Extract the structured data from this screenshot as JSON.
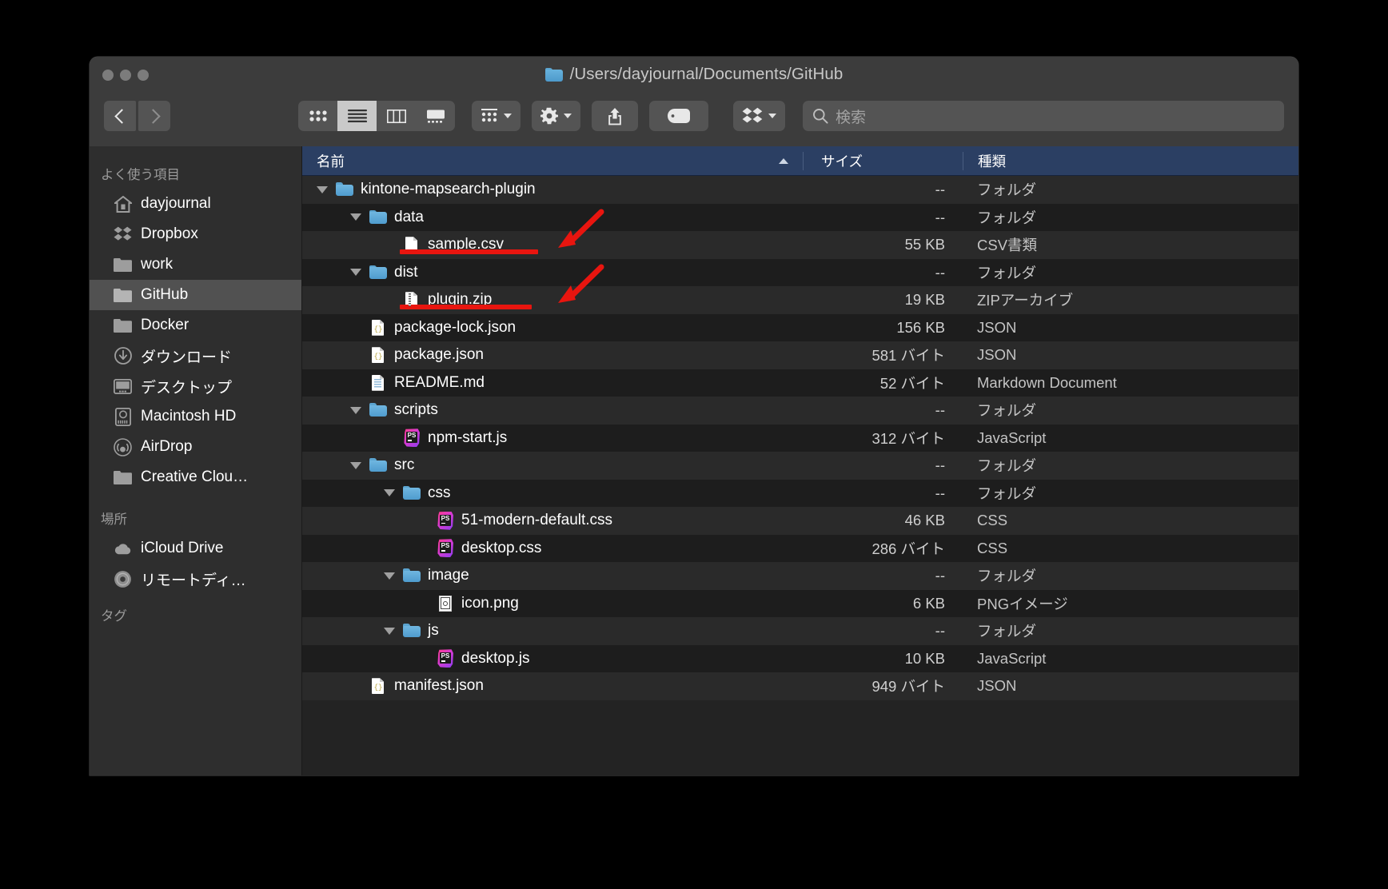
{
  "window": {
    "title": "/Users/dayjournal/Documents/GitHub",
    "traffic_lights": [
      "close",
      "minimize",
      "zoom"
    ]
  },
  "toolbar": {
    "back_label": "back",
    "forward_label": "forward",
    "view_buttons": [
      {
        "name": "icon-view",
        "selected": false
      },
      {
        "name": "list-view",
        "selected": true
      },
      {
        "name": "column-view",
        "selected": false
      },
      {
        "name": "gallery-view",
        "selected": false
      }
    ],
    "group_by_label": "group-by",
    "action_label": "action",
    "share_label": "share",
    "tag_label": "tag",
    "dropbox_label": "dropbox",
    "search_placeholder": "検索"
  },
  "sidebar": {
    "sections": [
      {
        "header": "よく使う項目",
        "items": [
          {
            "label": "dayjournal",
            "icon": "home-icon",
            "selected": false
          },
          {
            "label": "Dropbox",
            "icon": "dropbox-icon",
            "selected": false
          },
          {
            "label": "work",
            "icon": "folder-icon",
            "selected": false
          },
          {
            "label": "GitHub",
            "icon": "folder-icon",
            "selected": true
          },
          {
            "label": "Docker",
            "icon": "folder-icon",
            "selected": false
          },
          {
            "label": "ダウンロード",
            "icon": "downloads-icon",
            "selected": false
          },
          {
            "label": "デスクトップ",
            "icon": "desktop-icon",
            "selected": false
          },
          {
            "label": "Macintosh HD",
            "icon": "harddisk-icon",
            "selected": false
          },
          {
            "label": "AirDrop",
            "icon": "airdrop-icon",
            "selected": false
          },
          {
            "label": "Creative Clou…",
            "icon": "folder-icon",
            "selected": false
          }
        ]
      },
      {
        "header": "場所",
        "items": [
          {
            "label": "iCloud Drive",
            "icon": "cloud-icon",
            "selected": false
          },
          {
            "label": "リモートディ…",
            "icon": "disc-icon",
            "selected": false
          }
        ]
      },
      {
        "header": "タグ",
        "items": []
      }
    ]
  },
  "filelist": {
    "columns": [
      {
        "key": "name",
        "label": "名前",
        "sorted": true,
        "sort_dir": "asc"
      },
      {
        "key": "size",
        "label": "サイズ"
      },
      {
        "key": "kind",
        "label": "種類"
      }
    ],
    "rows": [
      {
        "name": "kintone-mapsearch-plugin",
        "size": "--",
        "kind": "フォルダ",
        "indent": 0,
        "icon": "folder-icon",
        "expanded": true
      },
      {
        "name": "data",
        "size": "--",
        "kind": "フォルダ",
        "indent": 1,
        "icon": "folder-icon",
        "expanded": true
      },
      {
        "name": "sample.csv",
        "size": "55 KB",
        "kind": "CSV書類",
        "indent": 2,
        "icon": "doc-icon",
        "expanded": null
      },
      {
        "name": "dist",
        "size": "--",
        "kind": "フォルダ",
        "indent": 1,
        "icon": "folder-icon",
        "expanded": true
      },
      {
        "name": "plugin.zip",
        "size": "19 KB",
        "kind": "ZIPアーカイブ",
        "indent": 2,
        "icon": "zip-icon",
        "expanded": null
      },
      {
        "name": "package-lock.json",
        "size": "156 KB",
        "kind": "JSON",
        "indent": 1,
        "icon": "json-icon",
        "expanded": null
      },
      {
        "name": "package.json",
        "size": "581 バイト",
        "kind": "JSON",
        "indent": 1,
        "icon": "json-icon",
        "expanded": null
      },
      {
        "name": "README.md",
        "size": "52 バイト",
        "kind": "Markdown Document",
        "indent": 1,
        "icon": "md-icon",
        "expanded": null
      },
      {
        "name": "scripts",
        "size": "--",
        "kind": "フォルダ",
        "indent": 1,
        "icon": "folder-icon",
        "expanded": true
      },
      {
        "name": "npm-start.js",
        "size": "312 バイト",
        "kind": "JavaScript",
        "indent": 2,
        "icon": "phpstorm-icon",
        "expanded": null
      },
      {
        "name": "src",
        "size": "--",
        "kind": "フォルダ",
        "indent": 1,
        "icon": "folder-icon",
        "expanded": true
      },
      {
        "name": "css",
        "size": "--",
        "kind": "フォルダ",
        "indent": 2,
        "icon": "folder-icon",
        "expanded": true
      },
      {
        "name": "51-modern-default.css",
        "size": "46 KB",
        "kind": "CSS",
        "indent": 3,
        "icon": "phpstorm-icon",
        "expanded": null
      },
      {
        "name": "desktop.css",
        "size": "286 バイト",
        "kind": "CSS",
        "indent": 3,
        "icon": "phpstorm-icon",
        "expanded": null
      },
      {
        "name": "image",
        "size": "--",
        "kind": "フォルダ",
        "indent": 2,
        "icon": "folder-icon",
        "expanded": true
      },
      {
        "name": "icon.png",
        "size": "6 KB",
        "kind": "PNGイメージ",
        "indent": 3,
        "icon": "png-icon",
        "expanded": null
      },
      {
        "name": "js",
        "size": "--",
        "kind": "フォルダ",
        "indent": 2,
        "icon": "folder-icon",
        "expanded": true
      },
      {
        "name": "desktop.js",
        "size": "10 KB",
        "kind": "JavaScript",
        "indent": 3,
        "icon": "phpstorm-icon",
        "expanded": null
      },
      {
        "name": "manifest.json",
        "size": "949 バイト",
        "kind": "JSON",
        "indent": 1,
        "icon": "json-icon",
        "expanded": null
      }
    ]
  },
  "annotations": {
    "color": "#e8150f",
    "items": [
      {
        "type": "underline",
        "target": "sample.csv"
      },
      {
        "type": "arrow",
        "target": "sample.csv"
      },
      {
        "type": "underline",
        "target": "plugin.zip"
      },
      {
        "type": "arrow",
        "target": "plugin.zip"
      }
    ]
  }
}
